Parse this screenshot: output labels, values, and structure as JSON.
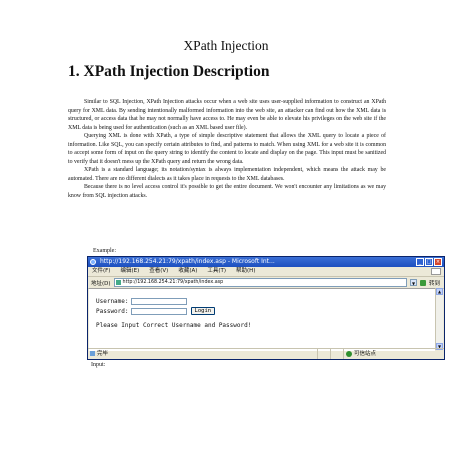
{
  "document": {
    "title": "XPath Injection",
    "section_heading": "1. XPath Injection Description",
    "paragraphs": [
      "Similar to SQL Injection, XPath Injection attacks occur when a web site uses user-supplied information to construct an XPath query for XML data. By sending intentionally malformed information into the web site, an attacker can find out how the XML data is structured, or access data that he may not normally have access to. He may even be able to elevate his privileges on the web site if the XML data is being used for authentication (such as an XML based user file).",
      "Querying XML is done with XPath, a type of simple descriptive statement that allows the XML query to locate a piece of information. Like SQL, you can specify certain attributes to find, and patterns to match. When using XML for a web site it is common to accept some form of input on the query string to identify the content to locate and display on the page. This input must be sanitized to verify that it doesn't mess up the XPath query and return the wrong data.",
      "XPath is a standard language; its notation/syntax is always implementation independent, which means the attack may be automated. There are no different dialects as it takes place in requests to the XML databases.",
      "Because there is no level access control it's possible to get the entire document. We won't encounter any limitations as we may know from SQL injection attacks."
    ],
    "example_label": "Example:",
    "input_label": "Input:"
  },
  "browser": {
    "window_title": "http://192.168.254.21:79/xpath/index.asp - Microsoft Int...",
    "menu": [
      "文件(F)",
      "编辑(E)",
      "查看(V)",
      "收藏(A)",
      "工具(T)",
      "帮助(H)"
    ],
    "address_label": "地址(D)",
    "address_value": "http://192.168.254.21:79/xpath/index.asp",
    "go_label": "转到",
    "form": {
      "username_label": "Username:",
      "password_label": "Password:",
      "username_value": "",
      "password_value": "",
      "login_button": "Login"
    },
    "message": "Please Input Correct Username and Password!",
    "status_left": "完毕",
    "status_zone": "Internet",
    "status_zone_cn": "可信站点"
  }
}
